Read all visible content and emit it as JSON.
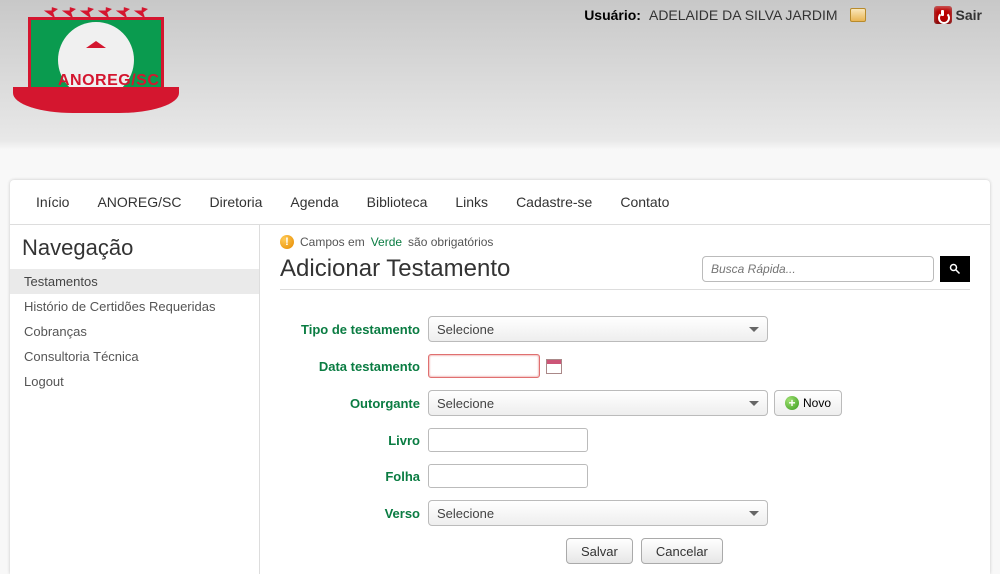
{
  "header": {
    "user_label": "Usuário:",
    "user_name": "ADELAIDE DA SILVA JARDIM",
    "logout": "Sair"
  },
  "logo": {
    "text": "ANOREG/SC"
  },
  "nav": [
    "Início",
    "ANOREG/SC",
    "Diretoria",
    "Agenda",
    "Biblioteca",
    "Links",
    "Cadastre-se",
    "Contato"
  ],
  "sidebar": {
    "title": "Navegação",
    "items": [
      "Testamentos",
      "Histório de Certidões Requeridas",
      "Cobranças",
      "Consultoria Técnica",
      "Logout"
    ]
  },
  "hint": {
    "prefix": "Campos em ",
    "green": "Verde",
    "suffix": " são obrigatórios"
  },
  "page_title": "Adicionar Testamento",
  "search": {
    "placeholder": "Busca Rápida..."
  },
  "form": {
    "tipo_label": "Tipo de testamento",
    "tipo_value": "Selecione",
    "data_label": "Data testamento",
    "data_value": "",
    "outorgante_label": "Outorgante",
    "outorgante_value": "Selecione",
    "novo_label": "Novo",
    "livro_label": "Livro",
    "livro_value": "",
    "folha_label": "Folha",
    "folha_value": "",
    "verso_label": "Verso",
    "verso_value": "Selecione",
    "save_label": "Salvar",
    "cancel_label": "Cancelar"
  }
}
